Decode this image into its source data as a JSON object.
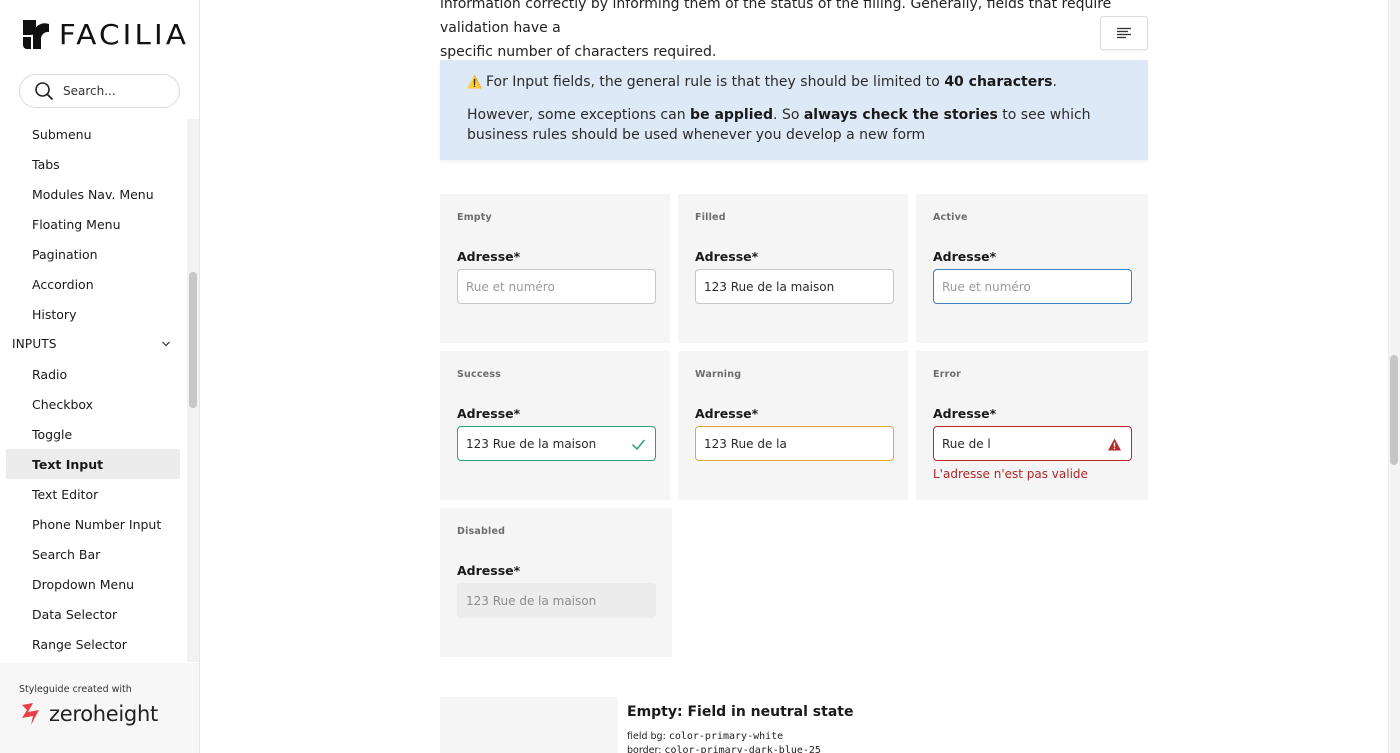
{
  "brand": {
    "name": "FACILIA"
  },
  "search": {
    "placeholder": "Search..."
  },
  "nav": {
    "items_top": [
      {
        "label": "Submenu"
      },
      {
        "label": "Tabs"
      },
      {
        "label": "Modules Nav. Menu"
      },
      {
        "label": "Floating Menu"
      },
      {
        "label": "Pagination"
      },
      {
        "label": "Accordion"
      },
      {
        "label": "History"
      }
    ],
    "section": {
      "label": "INPUTS"
    },
    "items_inputs": [
      {
        "label": "Radio"
      },
      {
        "label": "Checkbox"
      },
      {
        "label": "Toggle"
      },
      {
        "label": "Text Input",
        "active": true
      },
      {
        "label": "Text Editor"
      },
      {
        "label": "Phone Number Input"
      },
      {
        "label": "Search Bar"
      },
      {
        "label": "Dropdown Menu"
      },
      {
        "label": "Data Selector"
      },
      {
        "label": "Range Selector"
      }
    ]
  },
  "footer": {
    "caption": "Styleguide created with",
    "brand": "zeroheight",
    "brand_color": "#e8414a"
  },
  "content": {
    "intro_line1": "information correctly by informing them of the status of the filling. Generally, fields that require validation have a",
    "intro_line2": "specific number of characters required.",
    "callout": {
      "line1_a": "For Input fields, the general rule is that they should be limited to ",
      "line1_b": "40 characters",
      "line1_c": ".",
      "line2_a": "However, some exceptions can ",
      "line2_b": "be applied",
      "line2_c": ". So ",
      "line2_d": "always check the stories",
      "line2_e": " to see which business rules should be used whenever you develop a new form",
      "bg": "#dde9f6"
    },
    "states": [
      {
        "state": "Empty",
        "label": "Adresse*",
        "value": "",
        "placeholder": "Rue et numéro"
      },
      {
        "state": "Filled",
        "label": "Adresse*",
        "value": "123 Rue de la maison"
      },
      {
        "state": "Active",
        "label": "Adresse*",
        "value": "",
        "placeholder": "Rue et numéro",
        "border": "#3b82c4"
      },
      {
        "state": "Success",
        "label": "Adresse*",
        "value": "123 Rue de la maison",
        "icon": "check-icon",
        "border": "#2aa37a"
      },
      {
        "state": "Warning",
        "label": "Adresse*",
        "value": "123 Rue de la",
        "border": "#e1a83a"
      },
      {
        "state": "Error",
        "label": "Adresse*",
        "value": "Rue de l",
        "icon": "warning-triangle-icon",
        "border": "#b52a2a",
        "error": "L'adresse n'est pas valide"
      },
      {
        "state": "Disabled",
        "label": "Adresse*",
        "value": "123 Rue de la maison"
      }
    ],
    "bottom": {
      "title": "Empty: Field in neutral state",
      "spec1_label": "field bg: ",
      "spec1_value": "color-primary-white",
      "spec2_label": "border: ",
      "spec2_value": "color-primary-dark-blue-25"
    }
  }
}
